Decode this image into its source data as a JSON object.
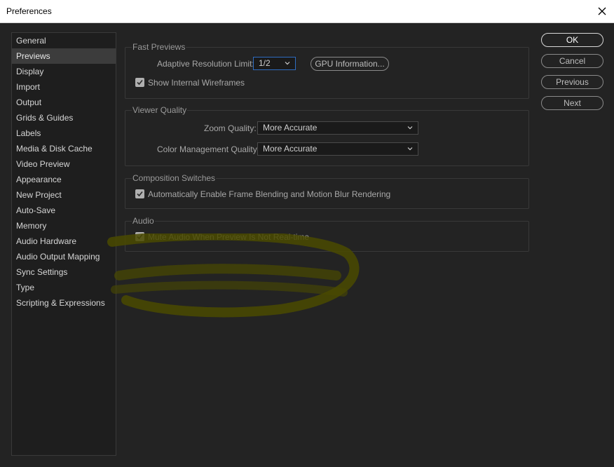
{
  "window": {
    "title": "Preferences"
  },
  "sidebar": {
    "items": [
      {
        "label": "General"
      },
      {
        "label": "Previews"
      },
      {
        "label": "Display"
      },
      {
        "label": "Import"
      },
      {
        "label": "Output"
      },
      {
        "label": "Grids & Guides"
      },
      {
        "label": "Labels"
      },
      {
        "label": "Media & Disk Cache"
      },
      {
        "label": "Video Preview"
      },
      {
        "label": "Appearance"
      },
      {
        "label": "New Project"
      },
      {
        "label": "Auto-Save"
      },
      {
        "label": "Memory"
      },
      {
        "label": "Audio Hardware"
      },
      {
        "label": "Audio Output Mapping"
      },
      {
        "label": "Sync Settings"
      },
      {
        "label": "Type"
      },
      {
        "label": "Scripting & Expressions"
      }
    ],
    "selected": "Previews"
  },
  "fast_previews": {
    "legend": "Fast Previews",
    "resolution_label": "Adaptive Resolution Limit:",
    "resolution_value": "1/2",
    "gpu_button": "GPU Information...",
    "wireframes_label": "Show Internal Wireframes",
    "wireframes_checked": true
  },
  "viewer_quality": {
    "legend": "Viewer Quality",
    "zoom_label": "Zoom Quality:",
    "zoom_value": "More Accurate",
    "color_label": "Color Management Quality:",
    "color_value": "More Accurate"
  },
  "composition_switches": {
    "legend": "Composition Switches",
    "frame_blending_label": "Automatically Enable Frame Blending and Motion Blur Rendering",
    "frame_blending_checked": true
  },
  "audio": {
    "legend": "Audio",
    "mute_label": "Mute Audio When Preview Is Not Real-time",
    "mute_checked": true
  },
  "buttons": {
    "ok": "OK",
    "cancel": "Cancel",
    "previous": "Previous",
    "next": "Next"
  },
  "colors": {
    "background": "#232323",
    "highlight_annotation": "#6b6b00"
  }
}
